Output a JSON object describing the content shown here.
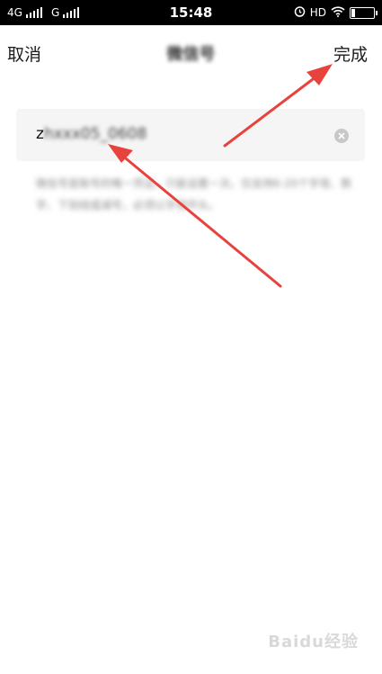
{
  "status_bar": {
    "network_1": "4G",
    "network_2": "G",
    "time": "15:48",
    "hd": "HD"
  },
  "nav": {
    "cancel_label": "取消",
    "title": "微信号",
    "done_label": "完成"
  },
  "input": {
    "value_visible": "z",
    "value_obscured": "hxxx05_0608"
  },
  "hint": {
    "text": "微信号是账号的唯一凭证，只能设置一次。仅支持6-20个字母、数字、下划线或减号，必须以字母开头。"
  },
  "annotation": {
    "color": "#e8423c"
  },
  "watermark": {
    "text": "Baidu经验"
  }
}
